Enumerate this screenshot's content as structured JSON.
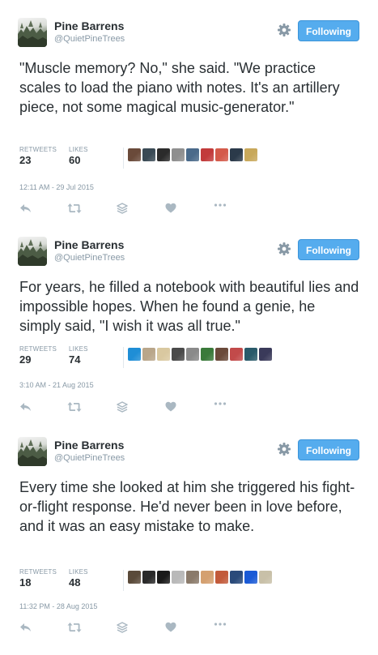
{
  "colors": {
    "follow_bg": "#55acee",
    "text": "#292f33",
    "muted": "#8899a6",
    "icon": "#aab8c2"
  },
  "icons": {
    "gear": "gear-icon",
    "reply": "reply-icon",
    "retweet": "retweet-icon",
    "share": "layers-icon",
    "like": "heart-icon",
    "more": "more-dots-icon"
  },
  "tweets": [
    {
      "display_name": "Pine Barrens",
      "handle": "@QuietPineTrees",
      "follow_label": "Following",
      "text": "\"Muscle memory? No,\" she said. \"We practice scales to load the piano with notes. It's an artillery piece, not some magical music-generator.\"",
      "retweets_label": "RETWEETS",
      "retweets": "23",
      "likes_label": "LIKES",
      "likes": "60",
      "timestamp": "12:11 AM - 29 Jul 2015",
      "liker_colors": [
        "#6a4a3a",
        "#3a4a55",
        "#2b2b2b",
        "#8f8f8f",
        "#4a6a8a",
        "#c23b3b",
        "#d45a4a",
        "#2b3a4a",
        "#c8a85a"
      ]
    },
    {
      "display_name": "Pine Barrens",
      "handle": "@QuietPineTrees",
      "follow_label": "Following",
      "text": "For years, he filled a notebook with beautiful lies and impossible hopes. When he found a genie, he simply said, \"I wish it was all true.\"",
      "retweets_label": "RETWEETS",
      "retweets": "29",
      "likes_label": "LIKES",
      "likes": "74",
      "timestamp": "3:10 AM - 21 Aug 2015",
      "liker_colors": [
        "#1f8ed6",
        "#b9a68a",
        "#d9c8a0",
        "#4a4a4a",
        "#8a8a8a",
        "#3a7a3a",
        "#6a4a3a",
        "#c24a4a",
        "#2a5a6a",
        "#3a3a5a"
      ]
    },
    {
      "display_name": "Pine Barrens",
      "handle": "@QuietPineTrees",
      "follow_label": "Following",
      "text": "Every time she looked at him she triggered his fight-or-flight response. He'd never been in love before, and it was an easy mistake to make.",
      "retweets_label": "RETWEETS",
      "retweets": "18",
      "likes_label": "LIKES",
      "likes": "48",
      "timestamp": "11:32 PM - 28 Aug 2015",
      "liker_colors": [
        "#5a4a3a",
        "#2a2a2a",
        "#1a1a1a",
        "#b9b9b9",
        "#8a7a6a",
        "#d4a070",
        "#c25a3a",
        "#2a4a7a",
        "#1a5ad6",
        "#c8c0a8"
      ]
    }
  ]
}
